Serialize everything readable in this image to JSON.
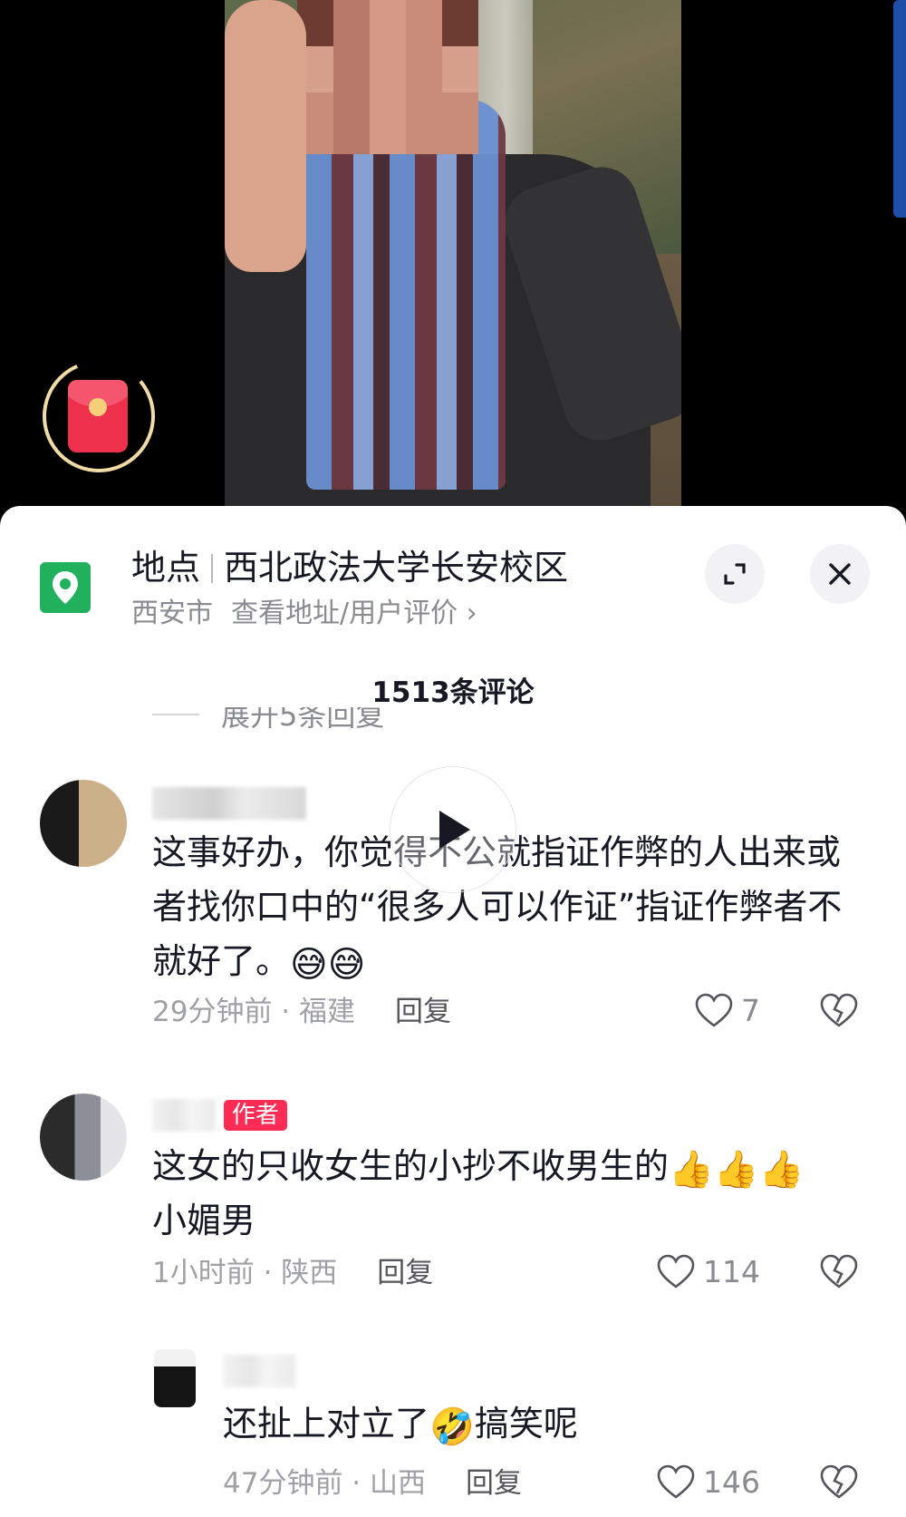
{
  "location": {
    "label": "地点",
    "name": "西北政法大学长安校区",
    "city": "西安市",
    "link": "查看地址/用户评价",
    "link_chevron": "›"
  },
  "comments_header": {
    "count_text": "1513条评论",
    "collapsed_text": "展开5条回复"
  },
  "comments": [
    {
      "text_part1": "这事好办，你觉得不公就指证作弊的人出来或者找你口中的“很多人可以作证”指证作弊者不就好了。",
      "emoji": "😅😅",
      "time": "29分钟前",
      "region": "福建",
      "reply_label": "回复",
      "likes": "7"
    },
    {
      "badge": "作者",
      "text_part1": "这女的只收女生的小抄不收男生的",
      "emoji": "👍👍👍",
      "text_part2": "小媚男",
      "time": "1小时前",
      "region": "陕西",
      "reply_label": "回复",
      "likes": "114"
    },
    {
      "text_part1": "还扯上对立了",
      "emoji": "🤣",
      "text_part2": "搞笑呢",
      "time": "47分钟前",
      "region": "山西",
      "reply_label": "回复",
      "likes": "146"
    }
  ],
  "meta_separator": " · ",
  "colors": {
    "accent_red": "#fe2c55",
    "location_green": "#21b15c",
    "muted_text": "#8a8b91"
  },
  "icons": [
    "map-pin-icon",
    "expand-icon",
    "close-icon",
    "play-icon",
    "heart-icon",
    "broken-heart-icon",
    "red-packet-icon"
  ]
}
